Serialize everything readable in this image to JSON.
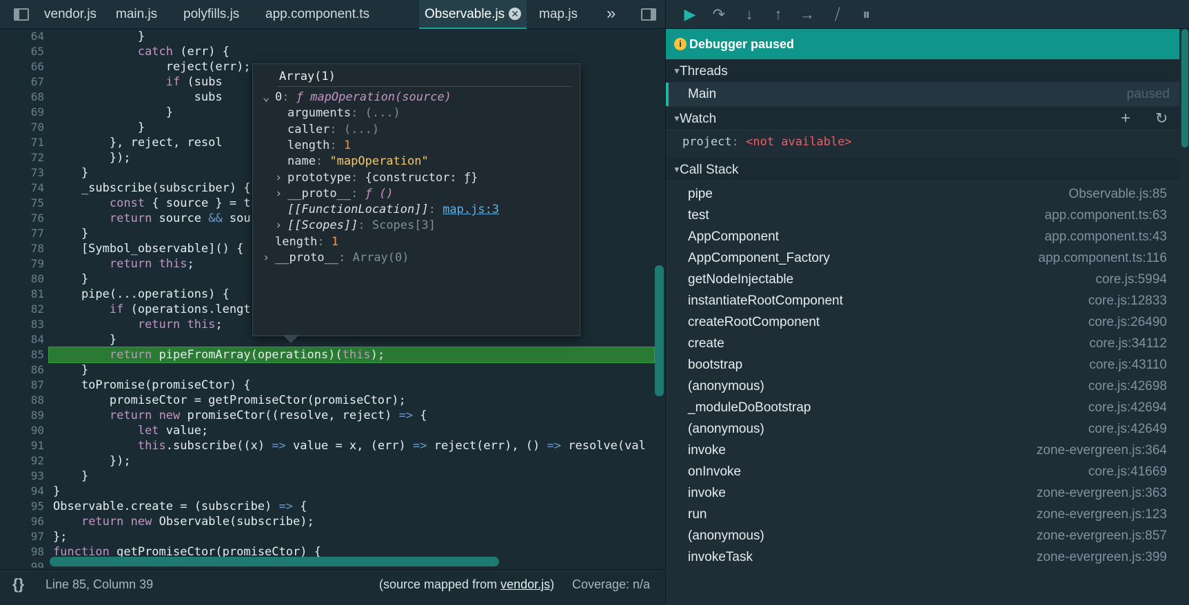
{
  "editor": {
    "tabs": [
      "vendor.js",
      "main.js",
      "polyfills.js",
      "app.component.ts",
      "Observable.js",
      "map.js"
    ],
    "active_tab": "Observable.js",
    "tab_close_glyph": "✕",
    "more_tabs_glyph": "»",
    "line_numbers": [
      "64",
      "65",
      "66",
      "67",
      "68",
      "69",
      "70",
      "71",
      "72",
      "73",
      "74",
      "75",
      "76",
      "77",
      "78",
      "79",
      "80",
      "81",
      "82",
      "83",
      "84",
      "85",
      "86",
      "87",
      "88",
      "89",
      "90",
      "91",
      "92",
      "93",
      "94",
      "95",
      "96",
      "97",
      "98",
      "99"
    ],
    "highlighted_line": "85",
    "code_lines": [
      "            }",
      "            catch (err) {",
      "                reject(err);",
      "                if (subs",
      "                    subs",
      "                }",
      "            }",
      "        }, reject, resol",
      "        });",
      "    }",
      "    _subscribe(subscriber) {",
      "        const { source } = t",
      "        return source && sou",
      "    }",
      "    [Symbol_observable]() {",
      "        return this;",
      "    }",
      "    pipe(...operations) {",
      "        if (operations.lengt",
      "            return this;",
      "        }",
      "        return pipeFromArray(operations)(this);",
      "    }",
      "    toPromise(promiseCtor) {",
      "        promiseCtor = getPromiseCtor(promiseCtor);",
      "        return new promiseCtor((resolve, reject) => {",
      "            let value;",
      "            this.subscribe((x) => value = x, (err) => reject(err), () => resolve(val",
      "        });",
      "    }",
      "}",
      "Observable.create = (subscribe) => {",
      "    return new Observable(subscribe);",
      "};",
      "function getPromiseCtor(promiseCtor) {",
      ""
    ]
  },
  "popover": {
    "title": "Array(1)",
    "rows": [
      {
        "arrow": "⌄",
        "key": "0",
        "sep": ": ",
        "pre": "ƒ ",
        "val": "mapOperation(source)",
        "kind": "func",
        "indent": 0
      },
      {
        "arrow": "",
        "key": "arguments",
        "sep": ": ",
        "pre": "",
        "val": "(...)",
        "kind": "dim",
        "indent": 1
      },
      {
        "arrow": "",
        "key": "caller",
        "sep": ": ",
        "pre": "",
        "val": "(...)",
        "kind": "dim",
        "indent": 1
      },
      {
        "arrow": "",
        "key": "length",
        "sep": ": ",
        "pre": "",
        "val": "1",
        "kind": "num",
        "indent": 1
      },
      {
        "arrow": "",
        "key": "name",
        "sep": ": ",
        "pre": "",
        "val": "\"mapOperation\"",
        "kind": "str",
        "indent": 1
      },
      {
        "arrow": "›",
        "key": "prototype",
        "sep": ": ",
        "pre": "",
        "val": "{constructor: ƒ}",
        "kind": "obj",
        "indent": 1
      },
      {
        "arrow": "›",
        "key": "__proto__",
        "sep": ": ",
        "pre": "ƒ ",
        "val": "()",
        "kind": "func",
        "indent": 1
      },
      {
        "arrow": "",
        "key": "[[FunctionLocation]]",
        "sep": ": ",
        "pre": "",
        "val": "map.js:3",
        "kind": "link",
        "indent": 1
      },
      {
        "arrow": "›",
        "key": "[[Scopes]]",
        "sep": ": ",
        "pre": "",
        "val": "Scopes[3]",
        "kind": "dim",
        "indent": 1
      },
      {
        "arrow": "",
        "key": "length",
        "sep": ": ",
        "pre": "",
        "val": "1",
        "kind": "num",
        "indent": 0
      },
      {
        "arrow": "›",
        "key": "__proto__",
        "sep": ": ",
        "pre": "",
        "val": "Array(0)",
        "kind": "dim",
        "indent": 0
      }
    ]
  },
  "status": {
    "braces": "{}",
    "cursor": "Line 85, Column 39",
    "source_prefix": "(source mapped from ",
    "source_file": "vendor.js",
    "source_suffix": ")",
    "coverage": "Coverage: n/a"
  },
  "debugger": {
    "banner": "Debugger paused",
    "info_glyph": "i",
    "sections": {
      "threads": "Threads",
      "watch": "Watch",
      "call_stack": "Call Stack"
    },
    "collapse_glyph": "▼",
    "thread": {
      "name": "Main",
      "status": "paused"
    },
    "watch_add": "+",
    "watch_refresh": "↻",
    "watch_expr": {
      "name": "project",
      "sep": ": ",
      "value": "<not available>"
    },
    "call_stack": [
      {
        "fn": "pipe",
        "loc": "Observable.js:85"
      },
      {
        "fn": "test",
        "loc": "app.component.ts:63"
      },
      {
        "fn": "AppComponent",
        "loc": "app.component.ts:43"
      },
      {
        "fn": "AppComponent_Factory",
        "loc": "app.component.ts:116"
      },
      {
        "fn": "getNodeInjectable",
        "loc": "core.js:5994"
      },
      {
        "fn": "instantiateRootComponent",
        "loc": "core.js:12833"
      },
      {
        "fn": "createRootComponent",
        "loc": "core.js:26490"
      },
      {
        "fn": "create",
        "loc": "core.js:34112"
      },
      {
        "fn": "bootstrap",
        "loc": "core.js:43110"
      },
      {
        "fn": "(anonymous)",
        "loc": "core.js:42698"
      },
      {
        "fn": "_moduleDoBootstrap",
        "loc": "core.js:42694"
      },
      {
        "fn": "(anonymous)",
        "loc": "core.js:42649"
      },
      {
        "fn": "invoke",
        "loc": "zone-evergreen.js:364"
      },
      {
        "fn": "onInvoke",
        "loc": "core.js:41669"
      },
      {
        "fn": "invoke",
        "loc": "zone-evergreen.js:363"
      },
      {
        "fn": "run",
        "loc": "zone-evergreen.js:123"
      },
      {
        "fn": "(anonymous)",
        "loc": "zone-evergreen.js:857"
      },
      {
        "fn": "invokeTask",
        "loc": "zone-evergreen.js:399"
      }
    ]
  },
  "toolbar_icons": [
    "resume-icon",
    "step-over-icon",
    "step-into-icon",
    "step-out-icon",
    "step-icon",
    "deactivate-breakpoints-icon",
    "pause-on-exceptions-icon"
  ],
  "toolbar_glyphs": [
    "▶",
    "↷",
    "↓",
    "↑",
    "→",
    "⧸",
    "⏸"
  ],
  "colors": {
    "accent": "#0f958a",
    "current_line": "#2a7a34",
    "editor_bg": "#1b2b34",
    "error_value": "#ec5f67"
  }
}
